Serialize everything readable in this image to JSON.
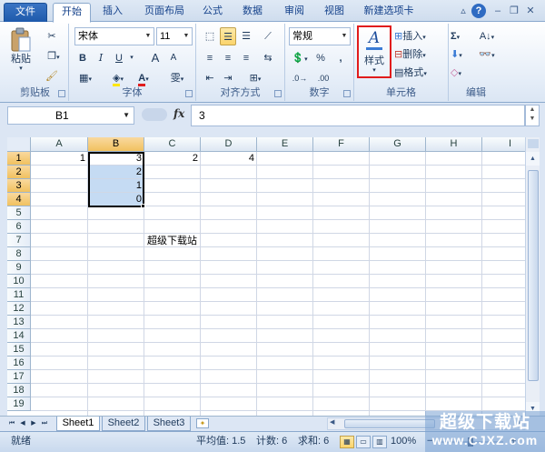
{
  "ribbon": {
    "file_tab": "文件",
    "tabs": [
      "开始",
      "插入",
      "页面布局",
      "公式",
      "数据",
      "审阅",
      "视图",
      "新建选项卡"
    ],
    "active_tab": "开始",
    "clipboard": {
      "label": "剪贴板",
      "paste": "粘贴"
    },
    "font": {
      "label": "字体",
      "font_name": "宋体",
      "font_size": "11",
      "bold": "B",
      "italic": "I",
      "underline": "U",
      "grow": "A",
      "shrink": "A",
      "font_color": "A",
      "phonetic": "雯"
    },
    "alignment": {
      "label": "对齐方式"
    },
    "number": {
      "label": "数字",
      "format": "常规",
      "percent": "%",
      "comma": ","
    },
    "styles": {
      "label": "样式"
    },
    "cells": {
      "label": "单元格",
      "insert": "插入",
      "delete": "删除",
      "format": "格式"
    },
    "editing": {
      "label": "编辑",
      "sum": "Σ"
    }
  },
  "formula_bar": {
    "name_box": "B1",
    "fx": "fx",
    "value": "3"
  },
  "columns": [
    "A",
    "B",
    "C",
    "D",
    "E",
    "F",
    "G",
    "H",
    "I"
  ],
  "selected_column": "B",
  "rows": [
    "1",
    "2",
    "3",
    "4",
    "5",
    "6",
    "7",
    "8",
    "9",
    "10",
    "11",
    "12",
    "13",
    "14",
    "15",
    "16",
    "17",
    "18",
    "19"
  ],
  "selected_rows": [
    "1",
    "2",
    "3",
    "4"
  ],
  "cells": {
    "A1": "1",
    "B1": "3",
    "B2": "2",
    "B3": "1",
    "B4": "0",
    "C1": "2",
    "D1": "4",
    "C7": "超级下载站"
  },
  "sheets": [
    "Sheet1",
    "Sheet2",
    "Sheet3"
  ],
  "active_sheet": "Sheet1",
  "status": {
    "ready": "就绪",
    "average": "平均值: 1.5",
    "count": "计数: 6",
    "sum": "求和: 6",
    "zoom": "100%"
  },
  "watermark": {
    "line1": "超级下载站",
    "line2": "www.CJXZ.com"
  }
}
